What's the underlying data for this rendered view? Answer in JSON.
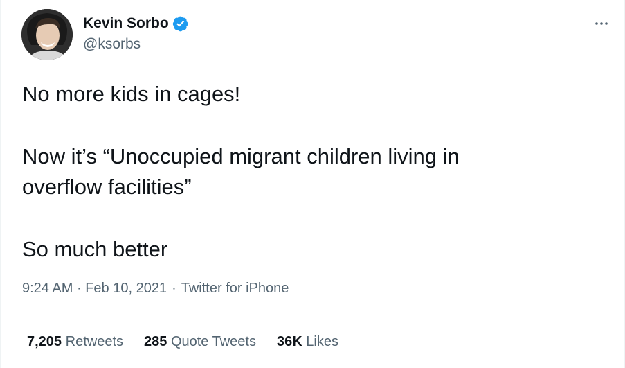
{
  "author": {
    "display_name": "Kevin Sorbo",
    "handle": "@ksorbs",
    "verified": true,
    "verified_color": "#1d9bf0"
  },
  "tweet": {
    "lines": [
      "No more kids in cages!",
      "Now it’s “Unoccupied migrant children living in",
      "overflow facilities”",
      "So much better"
    ],
    "time": "9:24 AM",
    "date": "Feb 10, 2021",
    "source": "Twitter for iPhone",
    "separator": "·"
  },
  "stats": {
    "retweets_count": "7,205",
    "retweets_label": "Retweets",
    "quotes_count": "285",
    "quotes_label": "Quote Tweets",
    "likes_count": "36K",
    "likes_label": "Likes"
  },
  "icons": {
    "more": "more-horizontal-icon",
    "verified": "verified-badge-icon"
  },
  "colors": {
    "text_primary": "#0f1419",
    "text_secondary": "#536471",
    "divider": "#eff3f4"
  }
}
